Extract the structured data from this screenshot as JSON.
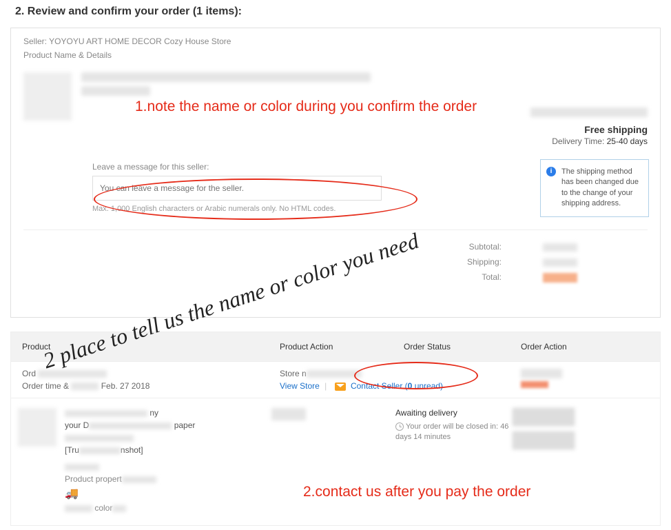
{
  "section": {
    "title": "2. Review and confirm your order (1 items):"
  },
  "order": {
    "seller_label": "Seller:",
    "seller_name": "YOYOYU ART HOME DECOR Cozy House Store",
    "product_details_label": "Product Name & Details",
    "leave_msg_label": "Leave a message for this seller:",
    "msg_placeholder": "You can leave a message for the seller.",
    "msg_hint": "Max. 1,000 English characters or Arabic numerals only. No HTML codes."
  },
  "shipping": {
    "free_label": "Free shipping",
    "delivery_label": "Delivery Time:",
    "delivery_value": "25-40 days",
    "notice": "The shipping method has been changed due to the change of your shipping address."
  },
  "totals": {
    "subtotal": "Subtotal:",
    "shipping": "Shipping:",
    "total": "Total:"
  },
  "annotations": {
    "red1": "1.note the name or color during you confirm the order",
    "red2": "2.contact us after you pay the order",
    "handwriting": "2 place to tell us the name or color you need"
  },
  "table": {
    "headers": {
      "product": "Product",
      "product_action": "Product Action",
      "order_status": "Order Status",
      "order_action": "Order Action"
    },
    "toprow": {
      "ord_prefix": "Ord",
      "order_time_prefix": "Order time &",
      "order_date": "Feb. 27 2018",
      "store_prefix": "Store n",
      "view_store": "View Store",
      "contact_seller": "Contact Seller (",
      "unread_count": "0",
      "unread_suffix": " unread)"
    },
    "detail": {
      "your_prefix": "your D",
      "paper_suffix": "paper",
      "tru_prefix": "[Tru",
      "nshot_suffix": "nshot]",
      "prop_label": "Product propert",
      "color_label": "color"
    },
    "status": {
      "awaiting": "Awaiting delivery",
      "close_text": "Your order will be closed in:",
      "close_time": "46 days 14 minutes"
    }
  }
}
